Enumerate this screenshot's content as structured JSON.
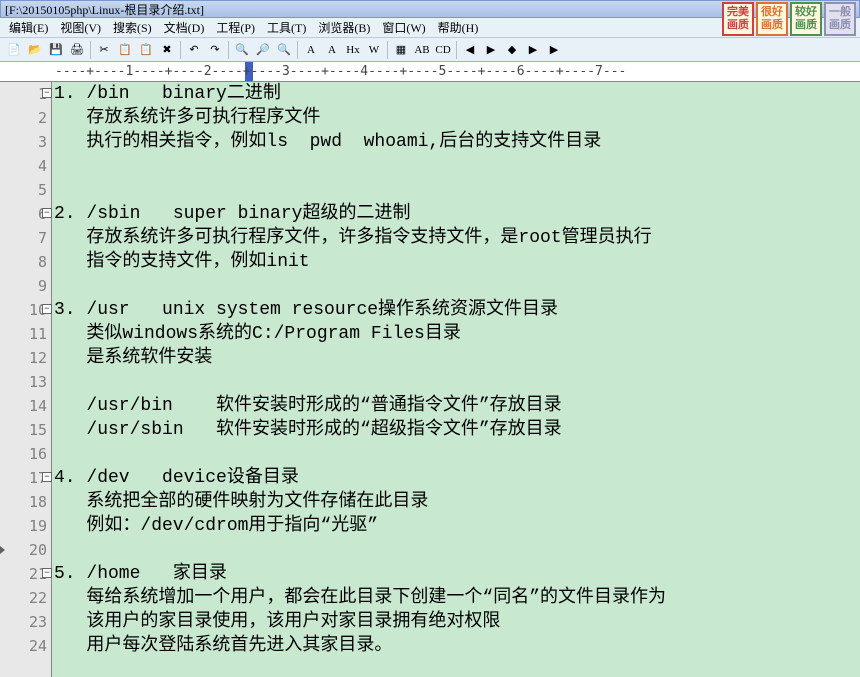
{
  "title": "[F:\\20150105php\\Linux-根目录介绍.txt]",
  "menus": [
    "编辑(E)",
    "视图(V)",
    "搜索(S)",
    "文档(D)",
    "工程(P)",
    "工具(T)",
    "浏览器(B)",
    "窗口(W)",
    "帮助(H)"
  ],
  "badges": [
    {
      "t1": "完美",
      "t2": "画质",
      "cls": "badge-red"
    },
    {
      "t1": "很好",
      "t2": "画质",
      "cls": "badge-orange"
    },
    {
      "t1": "较好",
      "t2": "画质",
      "cls": "badge-green"
    },
    {
      "t1": "一般",
      "t2": "画质",
      "cls": "badge-gray"
    }
  ],
  "ruler": "----+----1----+----2----+----3----+----4----+----5----+----6----+----7---",
  "lines": [
    {
      "n": 1,
      "fold": true,
      "t": "1. /bin   binary二进制"
    },
    {
      "n": 2,
      "t": "   存放系统许多可执行程序文件"
    },
    {
      "n": 3,
      "t": "   执行的相关指令，例如ls  pwd  whoami,后台的支持文件目录"
    },
    {
      "n": 4,
      "t": ""
    },
    {
      "n": 5,
      "t": ""
    },
    {
      "n": 6,
      "fold": true,
      "t": "2. /sbin   super binary超级的二进制"
    },
    {
      "n": 7,
      "t": "   存放系统许多可执行程序文件，许多指令支持文件，是root管理员执行"
    },
    {
      "n": 8,
      "t": "   指令的支持文件，例如init"
    },
    {
      "n": 9,
      "t": ""
    },
    {
      "n": 10,
      "fold": true,
      "t": "3. /usr   unix system resource操作系统资源文件目录"
    },
    {
      "n": 11,
      "t": "   类似windows系统的C:/Program Files目录"
    },
    {
      "n": 12,
      "t": "   是系统软件安装"
    },
    {
      "n": 13,
      "t": ""
    },
    {
      "n": 14,
      "t": "   /usr/bin    软件安装时形成的\"普通指令文件\"存放目录"
    },
    {
      "n": 15,
      "t": "   /usr/sbin   软件安装时形成的\"超级指令文件\"存放目录"
    },
    {
      "n": 16,
      "t": ""
    },
    {
      "n": 17,
      "fold": true,
      "t": "4. /dev   device设备目录"
    },
    {
      "n": 18,
      "t": "   系统把全部的硬件映射为文件存储在此目录"
    },
    {
      "n": 19,
      "t": "   例如：/dev/cdrom用于指向\"光驱\""
    },
    {
      "n": 20,
      "arrow": true,
      "t": ""
    },
    {
      "n": 21,
      "fold": true,
      "t": "5. /home   家目录"
    },
    {
      "n": 22,
      "t": "   每给系统增加一个用户，都会在此目录下创建一个\"同名\"的文件目录作为"
    },
    {
      "n": 23,
      "t": "   该用户的家目录使用，该用户对家目录拥有绝对权限"
    },
    {
      "n": 24,
      "t": "   用户每次登陆系统首先进入其家目录。"
    }
  ],
  "toolbar_icons": [
    {
      "name": "new-icon",
      "g": "📄"
    },
    {
      "name": "open-icon",
      "g": "📂"
    },
    {
      "name": "save-icon",
      "g": "💾"
    },
    {
      "name": "print-icon",
      "g": "🖨"
    },
    {
      "sep": true
    },
    {
      "name": "cut-icon",
      "g": "✂"
    },
    {
      "name": "copy-icon",
      "g": "📋"
    },
    {
      "name": "paste-icon",
      "g": "📋"
    },
    {
      "name": "delete-icon",
      "g": "✖"
    },
    {
      "sep": true
    },
    {
      "name": "undo-icon",
      "g": "↶"
    },
    {
      "name": "redo-icon",
      "g": "↷"
    },
    {
      "sep": true
    },
    {
      "name": "find-icon",
      "g": "🔍"
    },
    {
      "name": "find-next-icon",
      "g": "🔎"
    },
    {
      "name": "find-files-icon",
      "g": "🔍"
    },
    {
      "sep": true
    },
    {
      "name": "a-icon",
      "g": "A"
    },
    {
      "name": "a2-icon",
      "g": "A"
    },
    {
      "name": "hex-icon",
      "g": "Hx"
    },
    {
      "name": "w-icon",
      "g": "W"
    },
    {
      "sep": true
    },
    {
      "name": "compare-icon",
      "g": "▦"
    },
    {
      "name": "ab-icon",
      "g": "AB"
    },
    {
      "name": "cd-icon",
      "g": "CD"
    },
    {
      "sep": true
    },
    {
      "name": "nav1-icon",
      "g": "◀"
    },
    {
      "name": "nav2-icon",
      "g": "▶"
    },
    {
      "name": "nav3-icon",
      "g": "◆"
    },
    {
      "name": "nav4-icon",
      "g": "▶"
    },
    {
      "name": "nav5-icon",
      "g": "▶"
    }
  ]
}
